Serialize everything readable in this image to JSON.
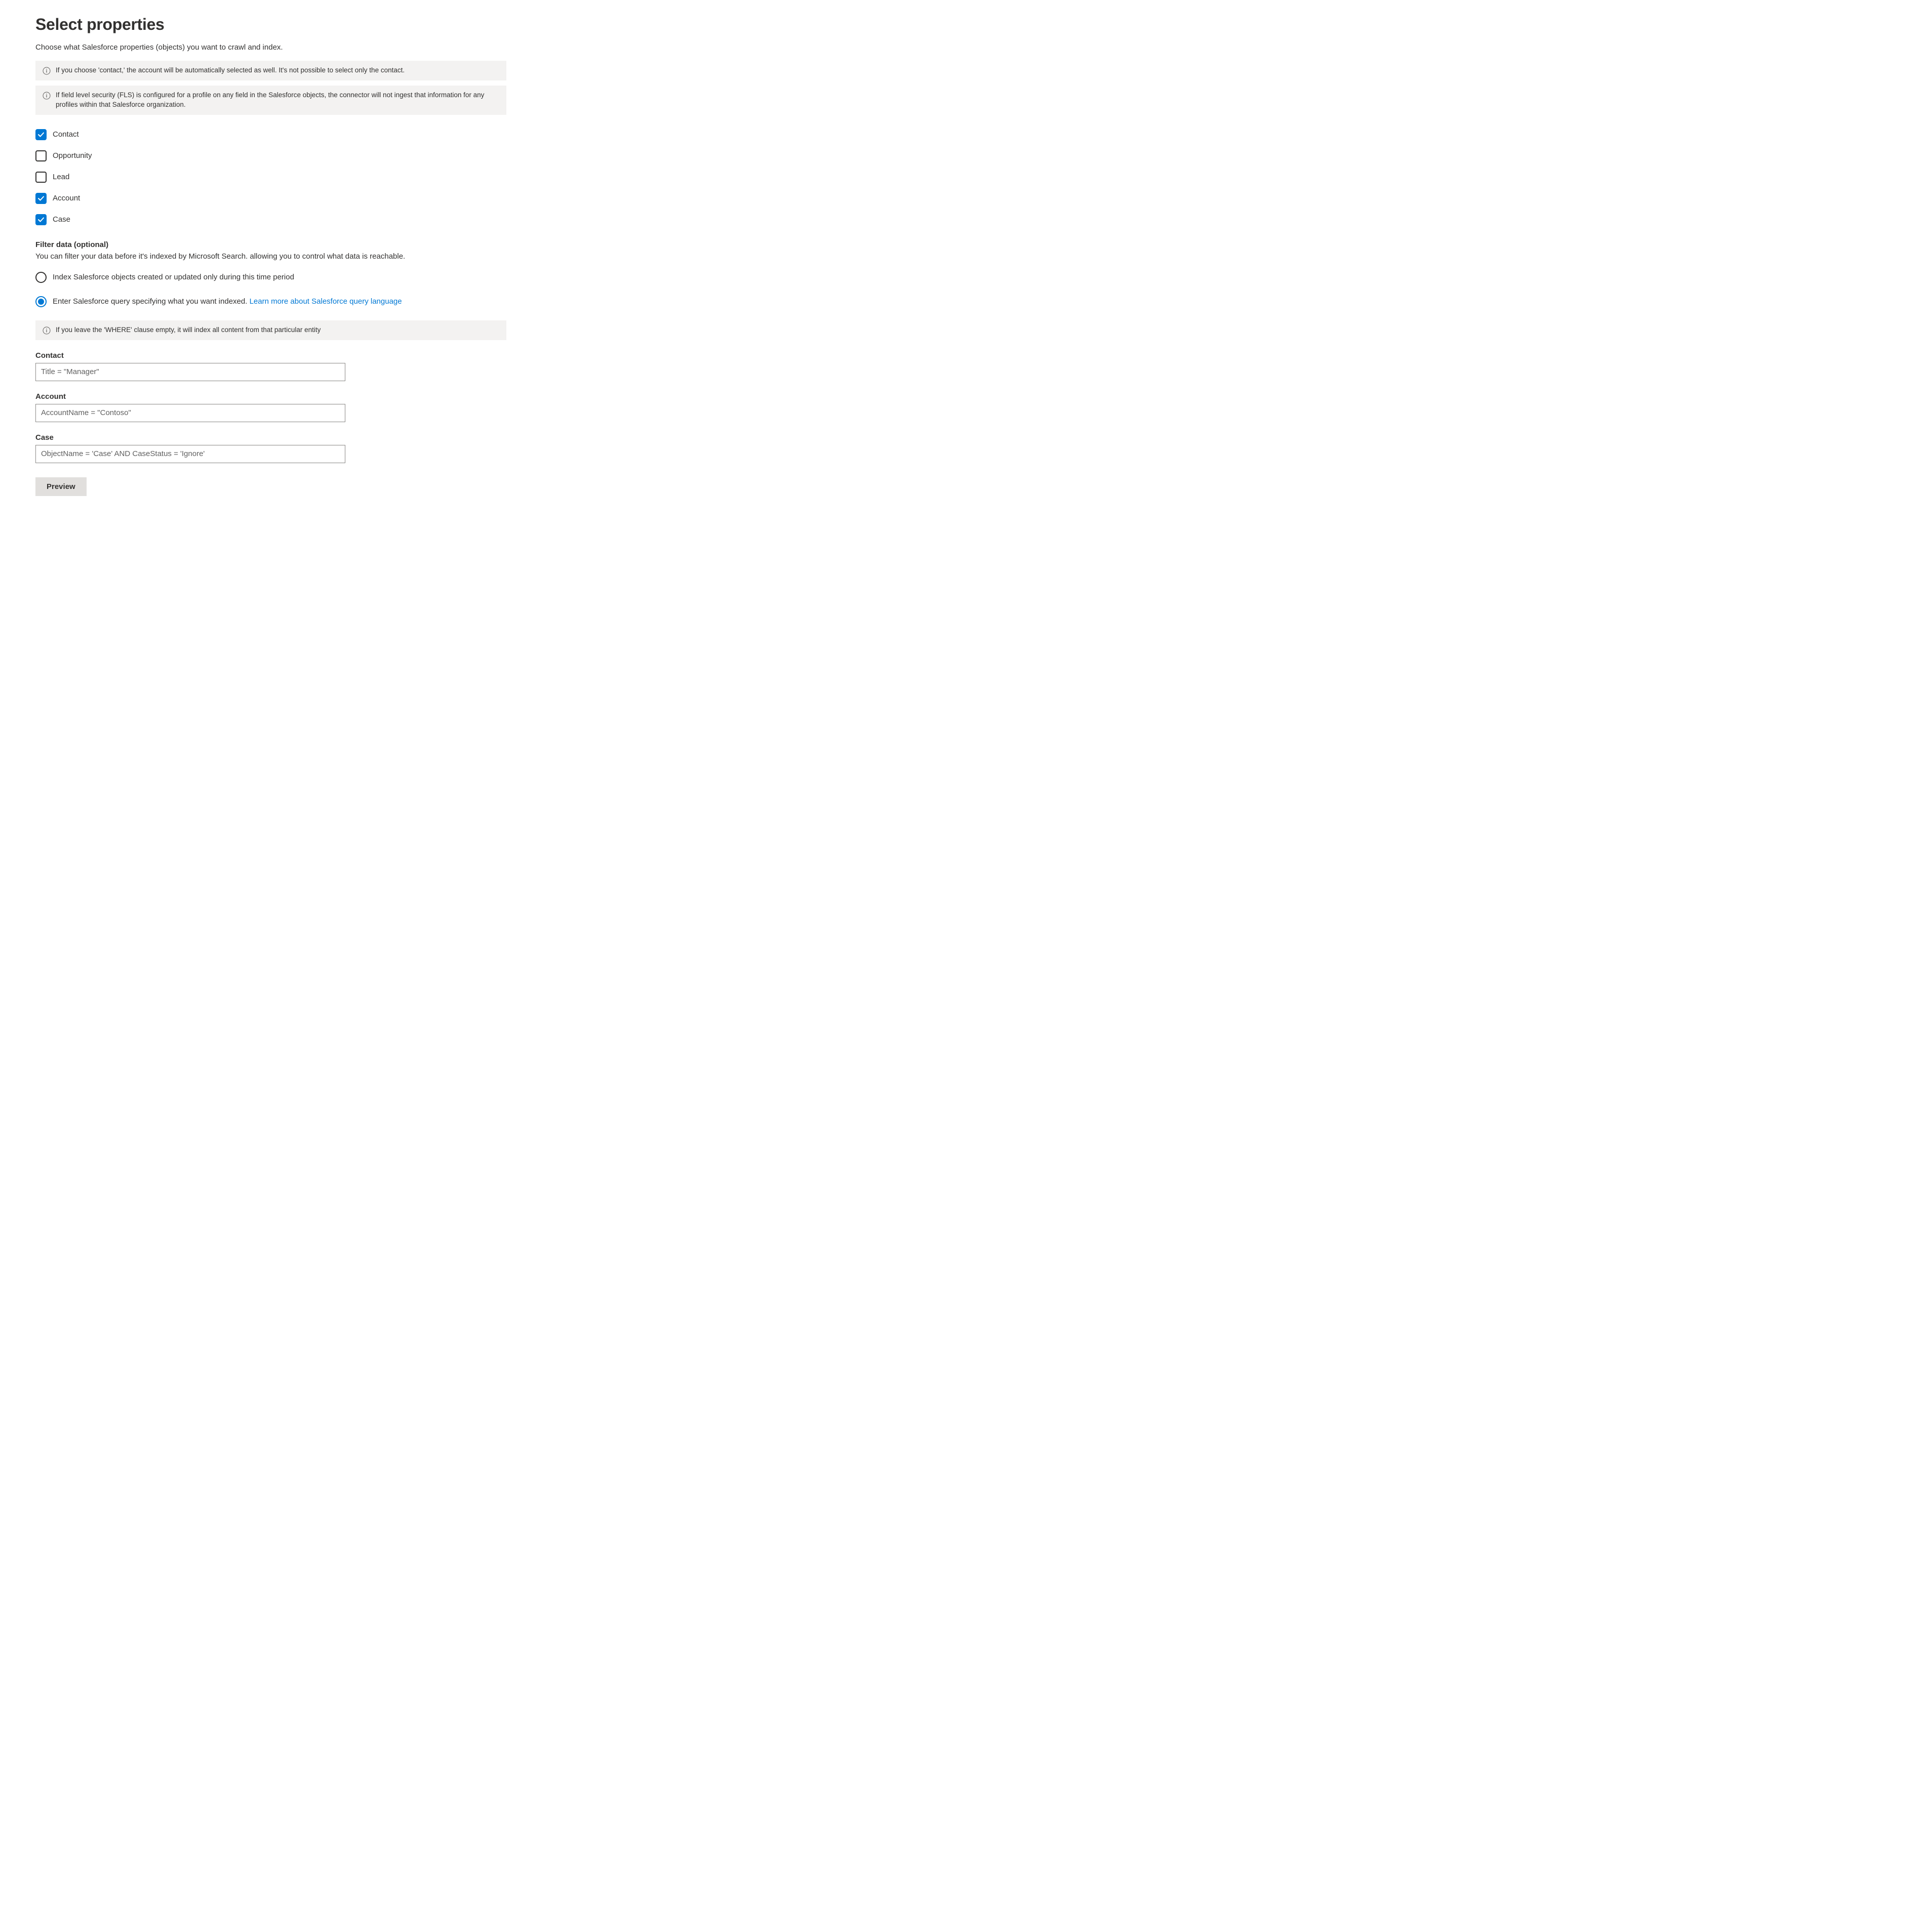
{
  "title": "Select properties",
  "subtitle": "Choose what Salesforce properties (objects) you want to crawl and index.",
  "info_bars": [
    "If you choose 'contact,' the account will be automatically selected as well. It's not possible to select only the contact.",
    "If field level security (FLS) is configured for a profile on any field in the Salesforce objects, the connector will not ingest that information for any profiles within that Salesforce organization."
  ],
  "checkboxes": [
    {
      "label": "Contact",
      "checked": true
    },
    {
      "label": "Opportunity",
      "checked": false
    },
    {
      "label": "Lead",
      "checked": false
    },
    {
      "label": "Account",
      "checked": true
    },
    {
      "label": "Case",
      "checked": true
    }
  ],
  "filter": {
    "heading": "Filter data (optional)",
    "desc": "You can filter your data before it's indexed by Microsoft Search. allowing you to control what data is reachable.",
    "radios": [
      {
        "label": "Index Salesforce objects created or updated only during this time period",
        "selected": false
      },
      {
        "label_pre": "Enter Salesforce query specifying what you want indexed. ",
        "link": "Learn more about Salesforce query language",
        "selected": true
      }
    ],
    "where_info": "If you leave the 'WHERE' clause empty, it will index all content from that particular entity",
    "fields": [
      {
        "label": "Contact",
        "value": "Title = \"Manager\""
      },
      {
        "label": "Account",
        "value": "AccountName = \"Contoso\""
      },
      {
        "label": "Case",
        "value": "ObjectName = 'Case' AND CaseStatus = 'Ignore'"
      }
    ]
  },
  "preview_btn": "Preview"
}
